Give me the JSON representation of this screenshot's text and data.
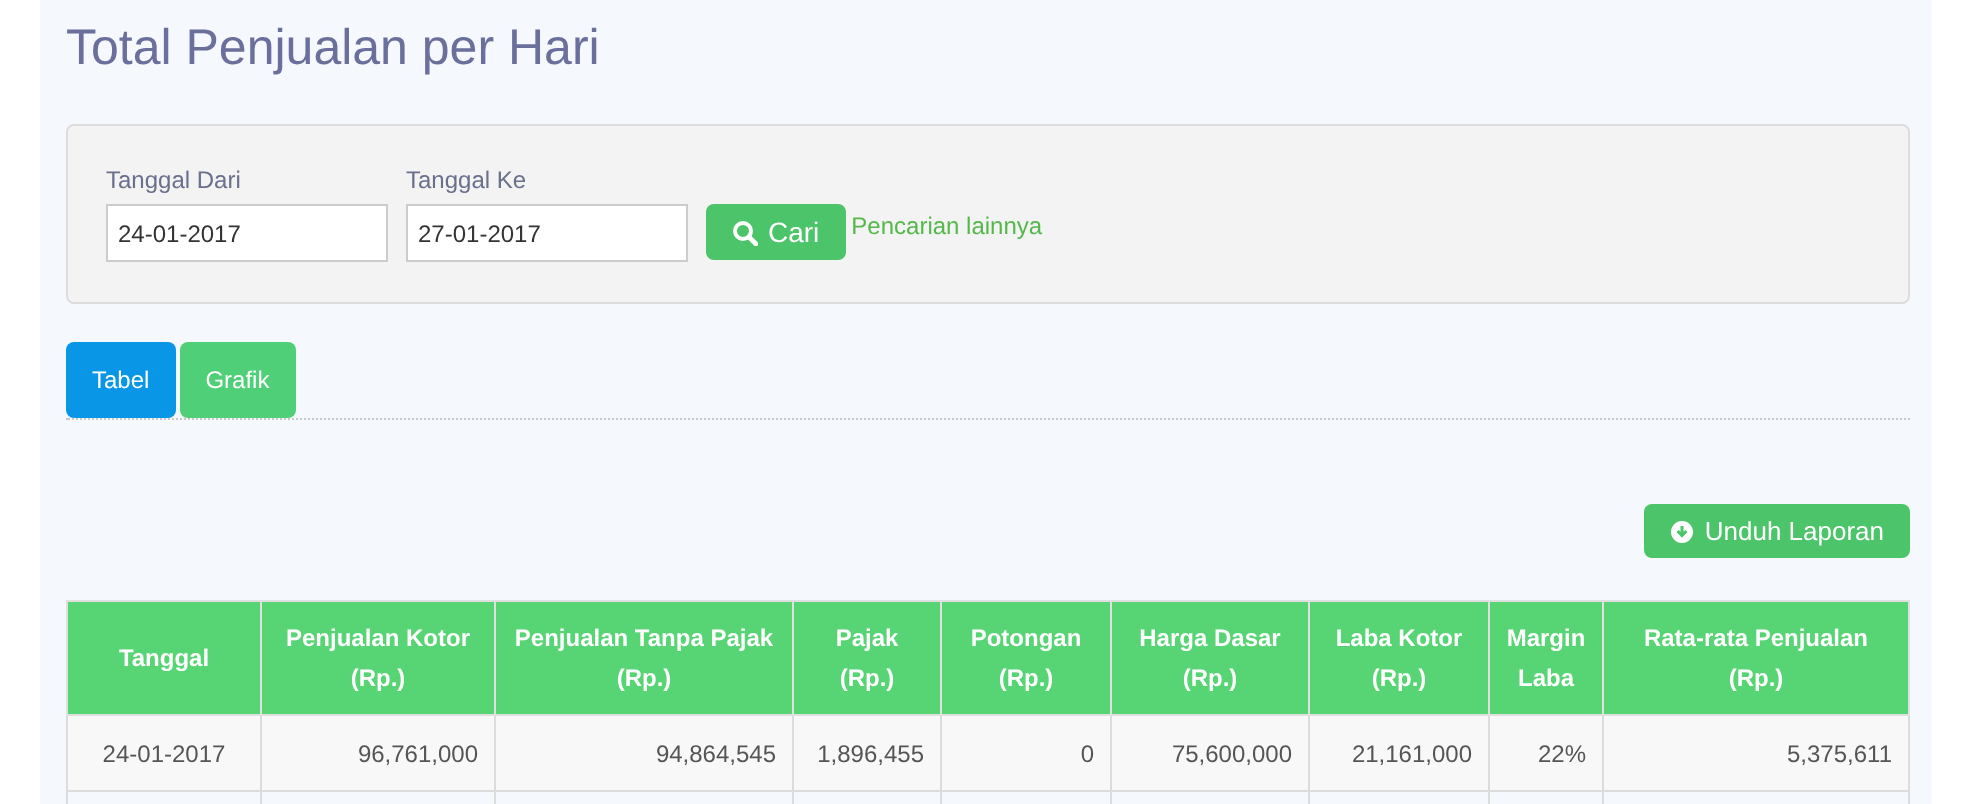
{
  "title": "Total Penjualan per Hari",
  "filter": {
    "fields": [
      {
        "label": "Tanggal Dari",
        "value": "24-01-2017"
      },
      {
        "label": "Tanggal Ke",
        "value": "27-01-2017"
      }
    ],
    "search_button": "Cari",
    "more_link": "Pencarian lainnya"
  },
  "tabs": [
    {
      "label": "Tabel",
      "selected": true
    },
    {
      "label": "Grafik",
      "selected": false
    }
  ],
  "download_button": "Unduh Laporan",
  "table": {
    "columns": [
      "Tanggal",
      "Penjualan Kotor\n(Rp.)",
      "Penjualan Tanpa Pajak\n(Rp.)",
      "Pajak\n(Rp.)",
      "Potongan\n(Rp.)",
      "Harga Dasar\n(Rp.)",
      "Laba Kotor\n(Rp.)",
      "Margin\nLaba",
      "Rata-rata Penjualan\n(Rp.)"
    ],
    "rows": [
      [
        "24-01-2017",
        "96,761,000",
        "94,864,545",
        "1,896,455",
        "0",
        "75,600,000",
        "21,161,000",
        "22%",
        "5,375,611"
      ]
    ]
  }
}
